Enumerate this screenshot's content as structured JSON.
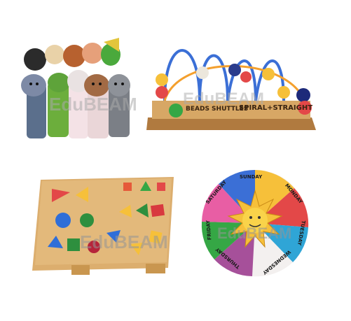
{
  "watermark": "EduBEAM",
  "products": {
    "bead_shuttle": {
      "line1": "BEADS SHUTTLES",
      "line2": "SPIRAL+STRAIGHT"
    },
    "days_puzzle": {
      "days": [
        "SUNDAY",
        "MONDAY",
        "TUESDAY",
        "WEDNESDAY",
        "THURSDAY",
        "FRIDAY",
        "SATURDAY"
      ]
    }
  }
}
